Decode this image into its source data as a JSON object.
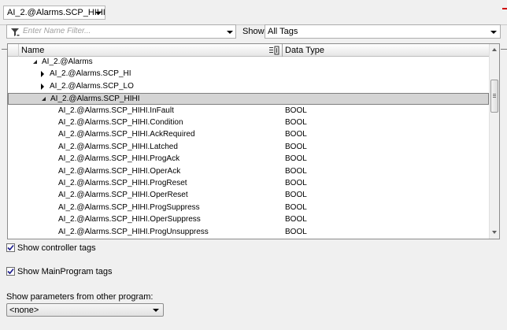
{
  "tag_selector": {
    "value": "AI_2.@Alarms.SCP_HIHI"
  },
  "filter": {
    "placeholder": "Enter Name Filter...",
    "icon": "funnel-icon"
  },
  "show": {
    "label": "Show:",
    "value": "All Tags"
  },
  "grid": {
    "columns": {
      "name": "Name",
      "data_type": "Data Type"
    },
    "rows": [
      {
        "label": "AI_2.@Alarms",
        "type": "",
        "expander": "expanded",
        "depth": 1,
        "selected": false
      },
      {
        "label": "AI_2.@Alarms.SCP_HI",
        "type": "",
        "expander": "collapsed",
        "depth": 2,
        "selected": false
      },
      {
        "label": "AI_2.@Alarms.SCP_LO",
        "type": "",
        "expander": "collapsed",
        "depth": 2,
        "selected": false
      },
      {
        "label": "AI_2.@Alarms.SCP_HIHI",
        "type": "",
        "expander": "expanded",
        "depth": 2,
        "selected": true
      },
      {
        "label": "AI_2.@Alarms.SCP_HIHI.InFault",
        "type": "BOOL",
        "expander": "none",
        "depth": 3,
        "selected": false
      },
      {
        "label": "AI_2.@Alarms.SCP_HIHI.Condition",
        "type": "BOOL",
        "expander": "none",
        "depth": 3,
        "selected": false
      },
      {
        "label": "AI_2.@Alarms.SCP_HIHI.AckRequired",
        "type": "BOOL",
        "expander": "none",
        "depth": 3,
        "selected": false
      },
      {
        "label": "AI_2.@Alarms.SCP_HIHI.Latched",
        "type": "BOOL",
        "expander": "none",
        "depth": 3,
        "selected": false
      },
      {
        "label": "AI_2.@Alarms.SCP_HIHI.ProgAck",
        "type": "BOOL",
        "expander": "none",
        "depth": 3,
        "selected": false
      },
      {
        "label": "AI_2.@Alarms.SCP_HIHI.OperAck",
        "type": "BOOL",
        "expander": "none",
        "depth": 3,
        "selected": false
      },
      {
        "label": "AI_2.@Alarms.SCP_HIHI.ProgReset",
        "type": "BOOL",
        "expander": "none",
        "depth": 3,
        "selected": false
      },
      {
        "label": "AI_2.@Alarms.SCP_HIHI.OperReset",
        "type": "BOOL",
        "expander": "none",
        "depth": 3,
        "selected": false
      },
      {
        "label": "AI_2.@Alarms.SCP_HIHI.ProgSuppress",
        "type": "BOOL",
        "expander": "none",
        "depth": 3,
        "selected": false
      },
      {
        "label": "AI_2.@Alarms.SCP_HIHI.OperSuppress",
        "type": "BOOL",
        "expander": "none",
        "depth": 3,
        "selected": false
      },
      {
        "label": "AI_2.@Alarms.SCP_HIHI.ProgUnsuppress",
        "type": "BOOL",
        "expander": "none",
        "depth": 3,
        "selected": false
      }
    ]
  },
  "options": {
    "show_controller_tags": {
      "label": "Show controller tags",
      "checked": true
    },
    "show_mainprogram_tags": {
      "label": "Show MainProgram tags",
      "checked": true
    }
  },
  "parameters": {
    "label": "Show parameters from other program:",
    "value": "<none>"
  }
}
